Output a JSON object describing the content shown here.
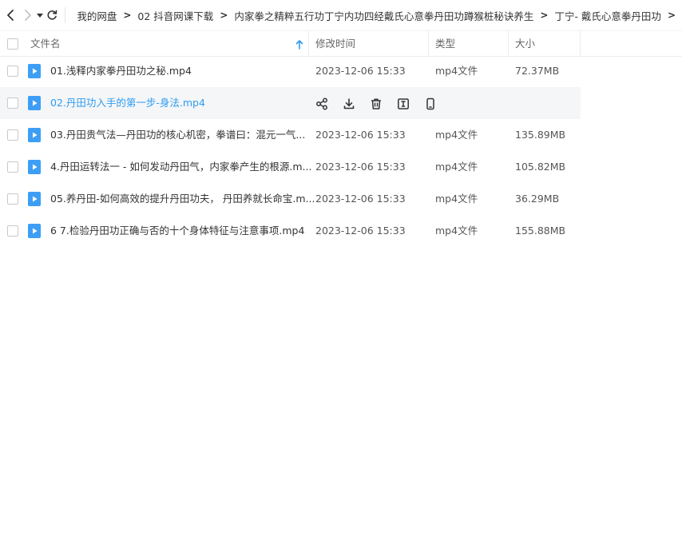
{
  "toolbar": {
    "breadcrumbs": [
      "我的网盘",
      "02 抖音网课下载",
      "内家拳之精粹五行功丁宁内功四经戴氏心意拳丹田功蹲猴桩秘诀养生",
      "丁宁- 戴氏心意拳丹田功"
    ]
  },
  "columns": {
    "name": "文件名",
    "modified": "修改时间",
    "type": "类型",
    "size": "大小"
  },
  "files": [
    {
      "name": "01.浅释内家拳丹田功之秘.mp4",
      "modified": "2023-12-06 15:33",
      "type": "mp4文件",
      "size": "72.37MB"
    },
    {
      "name": "02.丹田功入手的第一步-身法.mp4",
      "modified": "",
      "type": "",
      "size": ""
    },
    {
      "name": "03.丹田贵气法—丹田功的核心机密，拳谱曰：混元一气...",
      "modified": "2023-12-06 15:33",
      "type": "mp4文件",
      "size": "135.89MB"
    },
    {
      "name": "4.丹田运转法一 - 如何发动丹田气，内家拳产生的根源.m...",
      "modified": "2023-12-06 15:33",
      "type": "mp4文件",
      "size": "105.82MB"
    },
    {
      "name": "05.养丹田-如何高效的提升丹田功夫， 丹田养就长命宝.m...",
      "modified": "2023-12-06 15:33",
      "type": "mp4文件",
      "size": "36.29MB"
    },
    {
      "name": "6 7.检验丹田功正确与否的十个身体特征与注意事项.mp4",
      "modified": "2023-12-06 15:33",
      "type": "mp4文件",
      "size": "155.88MB"
    }
  ],
  "colors": {
    "accent": "#2d9cf0",
    "file_icon": "#3d9ef5",
    "hover_row": "#f5f6f8"
  },
  "icons": {
    "back": "chevron-left-icon",
    "forward": "chevron-right-icon",
    "history": "caret-down-icon",
    "refresh": "refresh-icon",
    "sort": "sort-ascending-icon",
    "file": "video-file-icon",
    "row_actions": [
      "share-icon",
      "download-icon",
      "delete-icon",
      "rename-icon",
      "phone-icon"
    ]
  }
}
